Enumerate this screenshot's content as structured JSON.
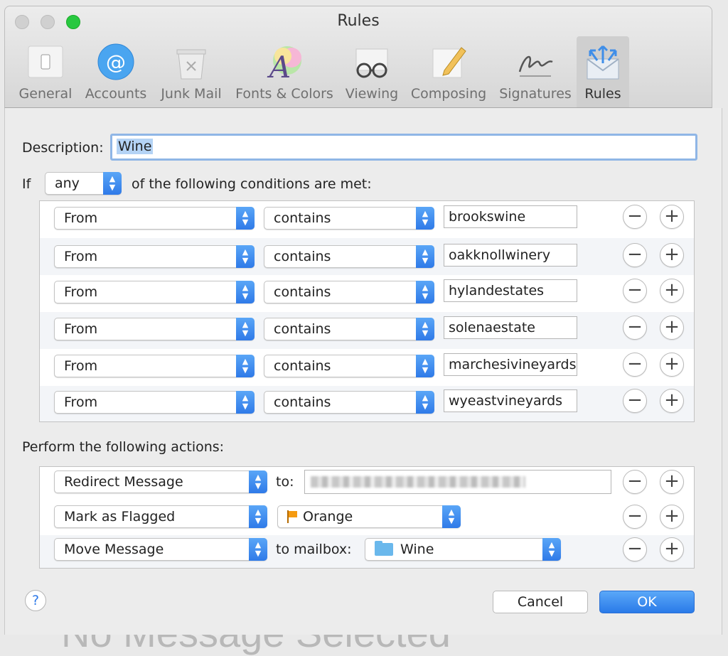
{
  "background_text": "No Message Selected",
  "window": {
    "title": "Rules"
  },
  "toolbar": {
    "items": [
      {
        "label": "General",
        "icon": "general-icon"
      },
      {
        "label": "Accounts",
        "icon": "at-icon"
      },
      {
        "label": "Junk Mail",
        "icon": "trash-icon"
      },
      {
        "label": "Fonts & Colors",
        "icon": "fonts-icon"
      },
      {
        "label": "Viewing",
        "icon": "glasses-icon"
      },
      {
        "label": "Composing",
        "icon": "pencil-icon"
      },
      {
        "label": "Signatures",
        "icon": "signature-icon"
      },
      {
        "label": "Rules",
        "icon": "rules-icon",
        "active": true
      }
    ]
  },
  "rule": {
    "description_label": "Description:",
    "description_value": "Wine",
    "if_label": "If",
    "match_value": "any",
    "conditions_suffix": "of the following conditions are met:",
    "conditions": [
      {
        "field": "From",
        "operator": "contains",
        "value": "brookswine"
      },
      {
        "field": "From",
        "operator": "contains",
        "value": "oakknollwinery"
      },
      {
        "field": "From",
        "operator": "contains",
        "value": "hylandestates"
      },
      {
        "field": "From",
        "operator": "contains",
        "value": "solenaestate"
      },
      {
        "field": "From",
        "operator": "contains",
        "value": "marchesivineyards"
      },
      {
        "field": "From",
        "operator": "contains",
        "value": "wyeastvineyards"
      }
    ],
    "actions_label": "Perform the following actions:",
    "actions": [
      {
        "action": "Redirect Message",
        "param_label": "to:",
        "param_value": ""
      },
      {
        "action": "Mark as Flagged",
        "param_value": "Orange"
      },
      {
        "action": "Move Message",
        "param_label": "to mailbox:",
        "param_value": "Wine"
      }
    ],
    "minus_symbol": "−",
    "plus_symbol": "+"
  },
  "footer": {
    "help_symbol": "?",
    "cancel_label": "Cancel",
    "ok_label": "OK"
  },
  "colors": {
    "accent": "#2f7ae8",
    "zoom_green": "#28c840",
    "flag_orange": "#f59b11",
    "folder_blue": "#6ab8ec"
  }
}
